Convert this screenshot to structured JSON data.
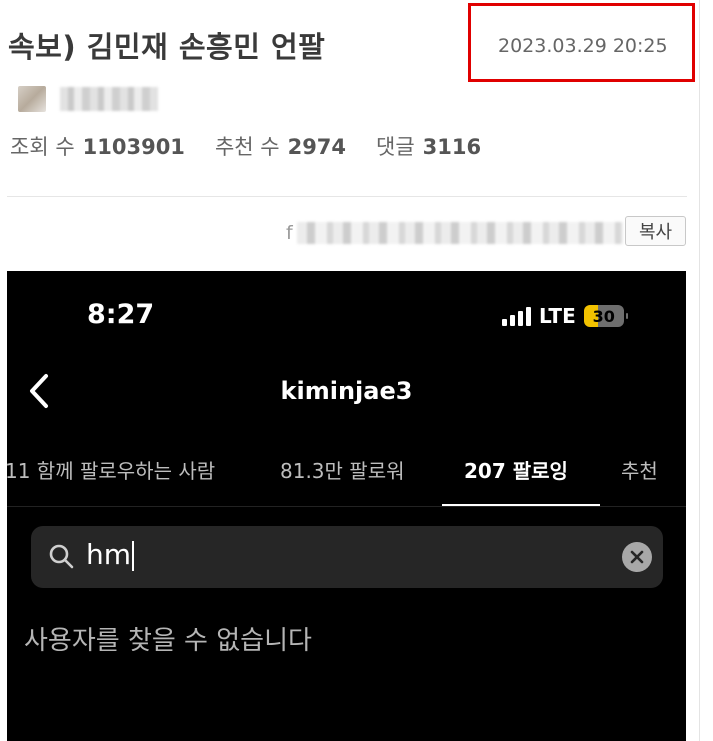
{
  "post": {
    "title": "속보) 김민재 손흥민 언팔",
    "date": "2023.03.29  20:25",
    "stats": [
      {
        "label": "조회 수",
        "value": "1103901"
      },
      {
        "label": "추천 수",
        "value": "2974"
      },
      {
        "label": "댓글",
        "value": "3116"
      }
    ],
    "url_prefix": "f",
    "copy_label": "복사"
  },
  "phone": {
    "time": "8:27",
    "network": "LTE",
    "battery": "30",
    "username": "kiminjae3",
    "tabs": [
      {
        "label": "11 함께 팔로우하는 사람"
      },
      {
        "label": "81.3만 팔로워"
      },
      {
        "label": "207 팔로잉"
      },
      {
        "label": "추천"
      }
    ],
    "search_value": "hm",
    "empty_message": "사용자를 찾을 수 없습니다"
  },
  "colors": {
    "highlight_box": "#e00000",
    "battery_fill": "#f2c200"
  }
}
